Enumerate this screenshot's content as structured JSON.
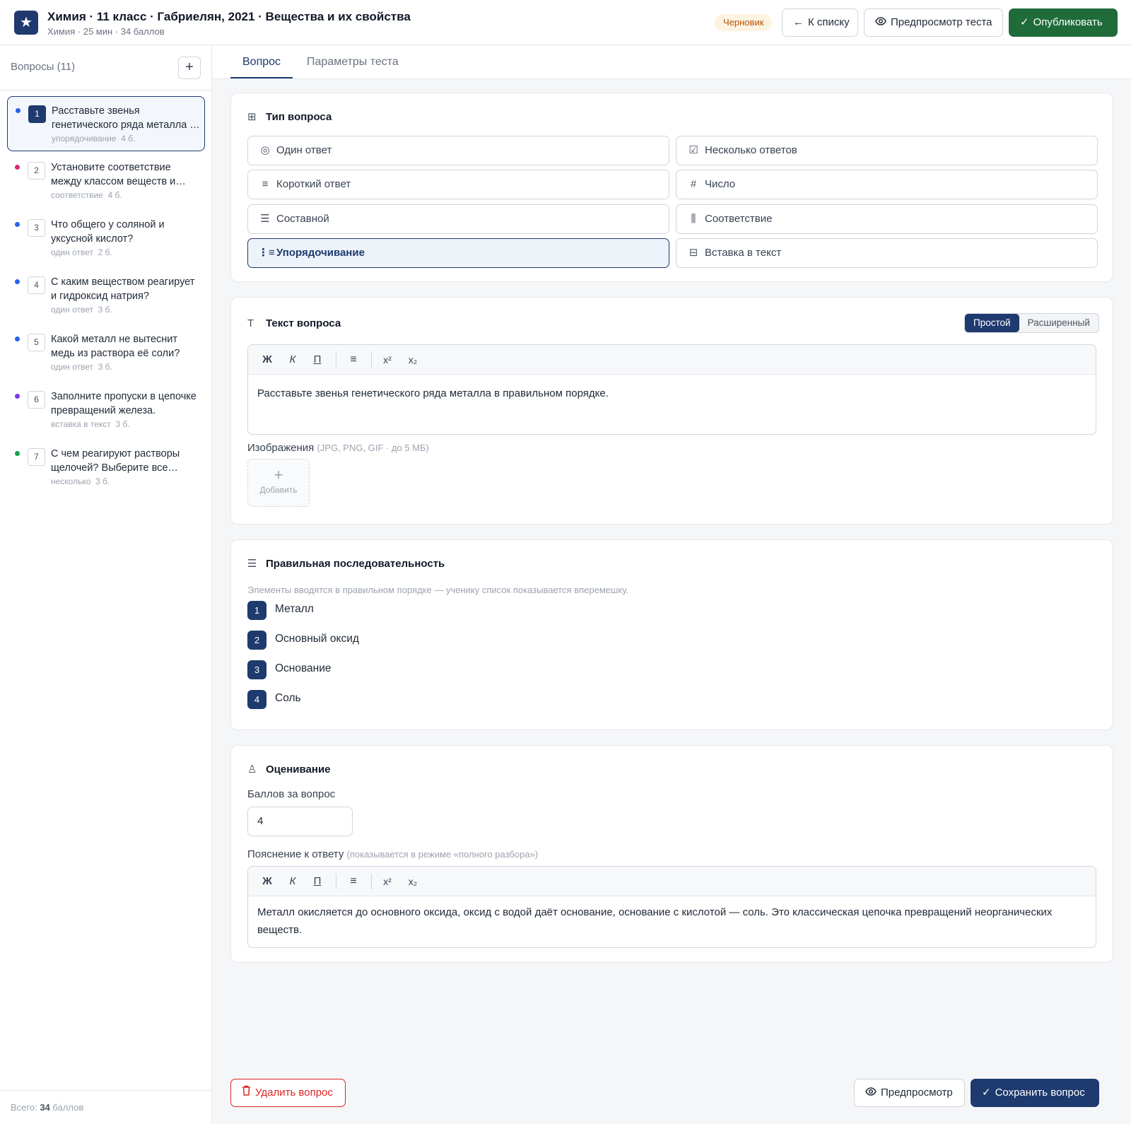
{
  "header": {
    "logo_glyph": "★",
    "title": "Химия · 11 класс · Габриелян, 2021 · Вещества и их свойства",
    "subtitle": "Химия · 25 мин · 34 баллов",
    "status_badge": "Черновик",
    "back_label": "К списку",
    "preview_label": "Предпросмотр теста",
    "publish_label": "Опубликовать"
  },
  "sidebar": {
    "title": "Вопросы (11)",
    "add_glyph": "+",
    "items": [
      {
        "num": "1",
        "text": "Расставьте звенья генетического ряда металла в правильном порядке.",
        "type": "упорядочивание",
        "points": "4 б.",
        "dot": "#2563eb"
      },
      {
        "num": "2",
        "text": "Установите соответствие между классом веществ и формулой.",
        "type": "соответствие",
        "points": "4 б.",
        "dot": "#db2777"
      },
      {
        "num": "3",
        "text": "Что общего у соляной и уксусной кислот?",
        "type": "один ответ",
        "points": "2 б.",
        "dot": "#2563eb"
      },
      {
        "num": "4",
        "text": "С каким веществом реагирует и гидроксид натрия?",
        "type": "один ответ",
        "points": "3 б.",
        "dot": "#2563eb"
      },
      {
        "num": "5",
        "text": "Какой металл не вытеснит медь из раствора её соли?",
        "type": "один ответ",
        "points": "3 б.",
        "dot": "#2563eb"
      },
      {
        "num": "6",
        "text": "Заполните пропуски в цепочке превращений железа.",
        "type": "вставка в текст",
        "points": "3 б.",
        "dot": "#7c3aed"
      },
      {
        "num": "7",
        "text": "С чем реагируют растворы щелочей? Выберите все варианты.",
        "type": "несколько",
        "points": "3 б.",
        "dot": "#16a34a"
      }
    ],
    "total_prefix": "Всего:",
    "total_value": "34",
    "total_suffix": "баллов"
  },
  "tabs": {
    "question": "Вопрос",
    "params": "Параметры теста"
  },
  "type_card": {
    "title": "Тип вопроса",
    "options": [
      {
        "label": "Один ответ",
        "icon": "◎"
      },
      {
        "label": "Несколько ответов",
        "icon": "☑"
      },
      {
        "label": "Короткий ответ",
        "icon": "≡"
      },
      {
        "label": "Число",
        "icon": "#"
      },
      {
        "label": "Составной",
        "icon": "☰"
      },
      {
        "label": "Соответствие",
        "icon": "⫼"
      },
      {
        "label": "Упорядочивание",
        "icon": "⋮≡"
      },
      {
        "label": "Вставка в текст",
        "icon": "⊟"
      }
    ],
    "selected": "Упорядочивание"
  },
  "text_card": {
    "title": "Текст вопроса",
    "mode_simple": "Простой",
    "mode_advanced": "Расширенный",
    "toolbar": {
      "bold": "Ж",
      "italic": "К",
      "underline": "П",
      "list": "≡",
      "sup": "x²",
      "sub": "x₂"
    },
    "body": "Расставьте звенья генетического ряда металла в правильном порядке.",
    "images_label": "Изображения",
    "images_hint": "(JPG, PNG, GIF · до 5 МБ)",
    "add_image_label": "Добавить"
  },
  "sequence_card": {
    "title": "Правильная последовательность",
    "hint": "Элементы вводятся в правильном порядке — ученику список показывается вперемешку.",
    "items": [
      {
        "num": "1",
        "text": "Металл"
      },
      {
        "num": "2",
        "text": "Основный оксид"
      },
      {
        "num": "3",
        "text": "Основание"
      },
      {
        "num": "4",
        "text": "Соль"
      }
    ]
  },
  "grading_card": {
    "title": "Оценивание",
    "points_label": "Баллов за вопрос",
    "points_value": "4",
    "explanation_label": "Пояснение к ответу",
    "explanation_hint": "(показывается в режиме «полного разбора»)",
    "explanation_body": "Металл окисляется до основного оксида, оксид с водой даёт основание, основание с кислотой — соль. Это классическая цепочка превращений неорганических веществ."
  },
  "footer": {
    "delete_label": "Удалить вопрос",
    "preview_label": "Предпросмотр",
    "save_label": "Сохранить вопрос"
  }
}
